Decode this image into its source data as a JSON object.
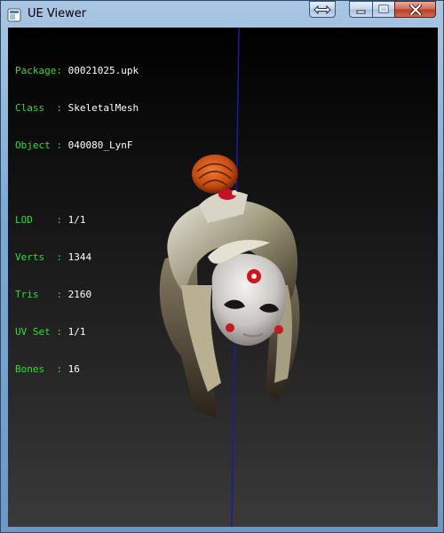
{
  "window": {
    "title": "UE Viewer",
    "icon": "ue-viewer-icon",
    "controls": {
      "swap": "restore-swap-icon",
      "minimize": "minimize-icon",
      "maximize": "maximize-icon",
      "close": "close-icon"
    }
  },
  "info": {
    "package": {
      "label": "Package:",
      "value": "00021025.upk"
    },
    "class": {
      "label": "Class  :",
      "value": "SkeletalMesh"
    },
    "object": {
      "label": "Object :",
      "value": "040080_LynF"
    },
    "lod": {
      "label": "LOD    :",
      "value": "1/1"
    },
    "verts": {
      "label": "Verts  :",
      "value": "1344"
    },
    "tris": {
      "label": "Tris   :",
      "value": "2160"
    },
    "uvset": {
      "label": "UV Set :",
      "value": "1/1"
    },
    "bones": {
      "label": "Bones  :",
      "value": "16"
    }
  },
  "colors": {
    "label_green": "#33dd33",
    "value_white": "#ffffff",
    "axis_blue": "#1a1aa8"
  }
}
